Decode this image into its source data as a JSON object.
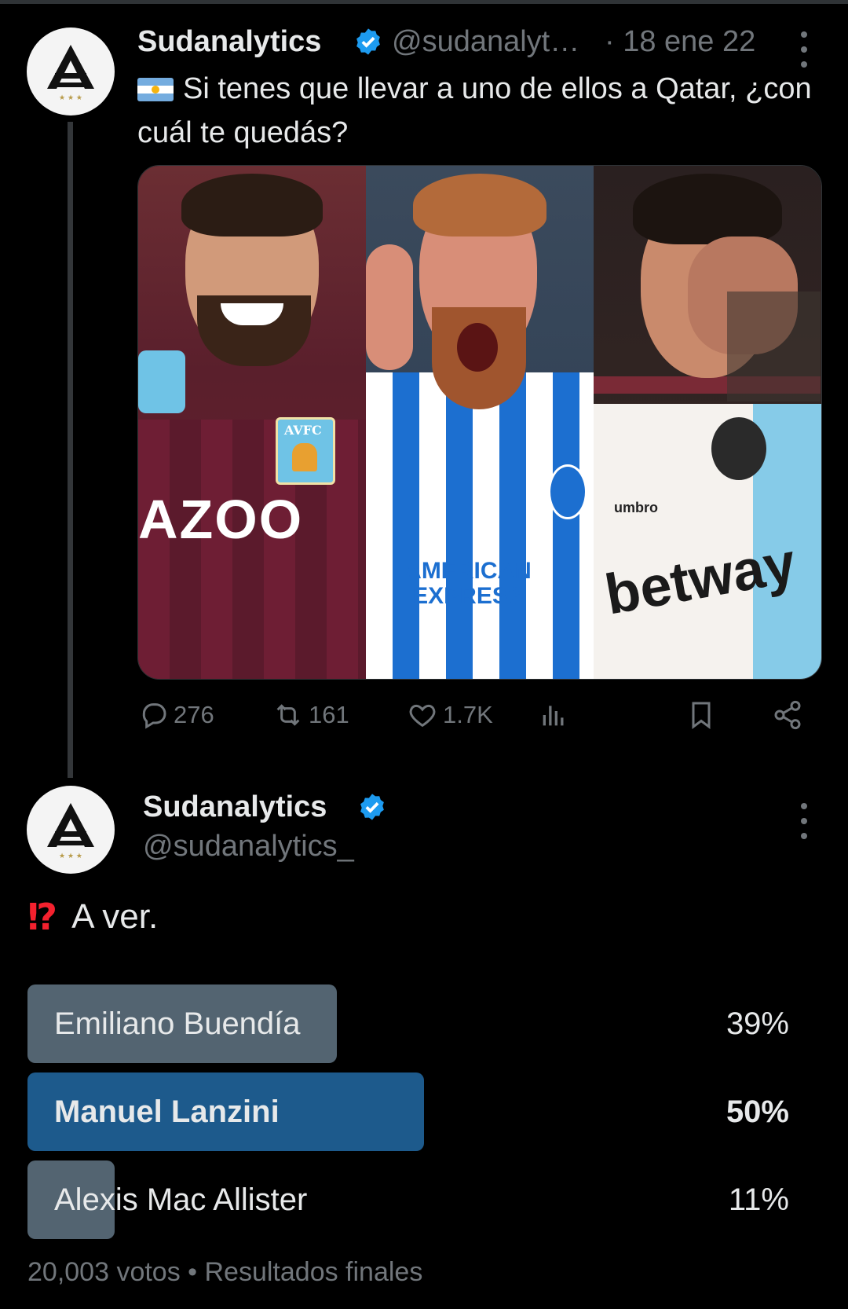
{
  "colors": {
    "background": "#000000",
    "text": "#e7e9ea",
    "muted": "#71767b",
    "verified": "#1d9bf0",
    "poll_bar": "#536471",
    "poll_winner": "#1d5a8c"
  },
  "quoted_tweet": {
    "author_name": "Sudanalytics",
    "handle": "@sudanalyt…",
    "date": "· 18 ene 22",
    "flag_icon": "argentina-flag",
    "text": "Si tenes que llevar a uno de ellos a Qatar, ¿con cuál te quedás?",
    "media": {
      "panels": [
        {
          "kit": "claret-blue",
          "sponsor": "AZOO",
          "badge": "AVFC"
        },
        {
          "kit": "blue-white-stripes",
          "sponsor": "AMERICAN EXPRESS"
        },
        {
          "kit": "white-sky-blue",
          "sponsor": "betway",
          "brand": "umbro"
        }
      ]
    },
    "stats": {
      "replies": "276",
      "retweets": "161",
      "likes": "1.7K"
    }
  },
  "main_tweet": {
    "author_name": "Sudanalytics",
    "handle": "@sudanalytics_",
    "text": "A ver.",
    "emoji": "⁉"
  },
  "poll": {
    "options": [
      {
        "label": "Emiliano Buendía",
        "percent_text": "39%",
        "percent": 39,
        "winner": false
      },
      {
        "label": "Manuel Lanzini",
        "percent_text": "50%",
        "percent": 50,
        "winner": true
      },
      {
        "label": "Alexis Mac Allister",
        "percent_text": "11%",
        "percent": 11,
        "winner": false
      }
    ],
    "footer": "20,003 votos • Resultados finales"
  }
}
